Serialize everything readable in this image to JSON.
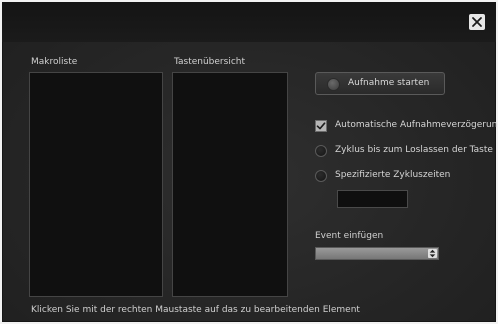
{
  "dialog": {
    "close_icon": "close-icon"
  },
  "macro_list": {
    "label": "Makroliste",
    "items": []
  },
  "key_overview": {
    "label": "Tastenübersicht",
    "items": []
  },
  "record": {
    "label": "Aufnahme starten",
    "icon": "record-dot-icon"
  },
  "options": {
    "auto_delay": {
      "label": "Automatische Aufnahmeverzögerung",
      "checked": true
    },
    "cycle_until_release": {
      "label": "Zyklus bis zum Loslassen der Taste",
      "selected": false
    },
    "specified_cycle_times": {
      "label": "Spezifizierte Zykluszeiten",
      "selected": false
    },
    "cycle_times_value": ""
  },
  "event": {
    "label": "Event einfügen",
    "selected_value": ""
  },
  "footer": {
    "hint": "Klicken Sie mit der rechten Maustaste auf das zu bearbeitenden Element"
  },
  "colors": {
    "background": "#262626",
    "titlebar": "#161616",
    "list_background": "#101010",
    "text": "#d0d0d0"
  }
}
